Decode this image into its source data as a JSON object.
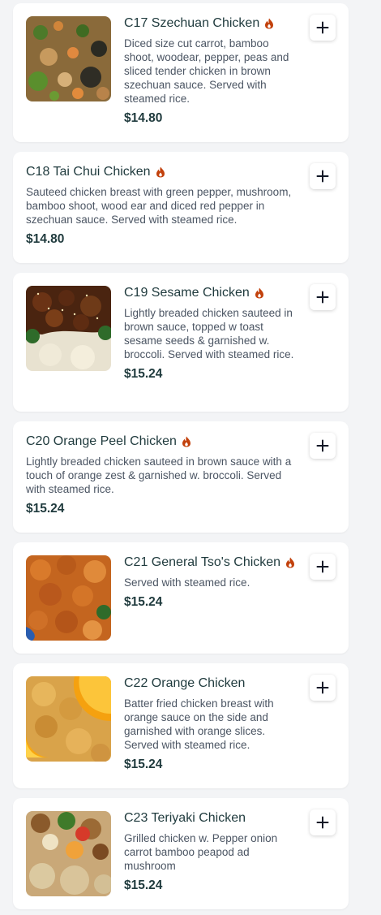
{
  "menu": {
    "items": [
      {
        "name": "C17 Szechuan Chicken",
        "spicy": true,
        "has_image": true,
        "image": "szechuan-chicken-photo",
        "description": "Diced size cut carrot, bamboo shoot, woodear, pepper, peas and sliced tender chicken in brown szechuan sauce. Served with steamed rice.",
        "price": "$14.80"
      },
      {
        "name": "C18 Tai Chui Chicken",
        "spicy": true,
        "has_image": false,
        "description": "Sauteed chicken breast with green pepper, mushroom, bamboo shoot, wood ear and diced red pepper in szechuan sauce. Served with steamed rice.",
        "price": "$14.80"
      },
      {
        "name": "C19 Sesame Chicken",
        "spicy": true,
        "has_image": true,
        "image": "sesame-chicken-photo",
        "description": "Lightly breaded chicken sauteed in brown sauce, topped w toast sesame seeds & garnished w. broccoli. Served with steamed rice.",
        "price": "$15.24"
      },
      {
        "name": "C20 Orange Peel Chicken",
        "spicy": true,
        "has_image": false,
        "description": "Lightly breaded chicken sauteed in brown sauce with a touch of orange zest & garnished w. broccoli. Served with steamed rice.",
        "price": "$15.24"
      },
      {
        "name": "C21 General Tso's Chicken",
        "spicy": true,
        "has_image": true,
        "image": "general-tsos-chicken-photo",
        "description": "Served with steamed rice.",
        "price": "$15.24"
      },
      {
        "name": "C22 Orange Chicken",
        "spicy": false,
        "has_image": true,
        "image": "orange-chicken-photo",
        "description": "Batter fried chicken breast with orange sauce on the side and garnished with orange slices. Served with steamed rice.",
        "price": "$15.24"
      },
      {
        "name": "C23 Teriyaki Chicken",
        "spicy": false,
        "has_image": true,
        "image": "teriyaki-chicken-photo",
        "description": "Grilled chicken w. Pepper onion carrot bamboo peapod ad mushroom",
        "price": "$15.24"
      }
    ]
  },
  "icons": {
    "spicy": "flame-icon",
    "add": "plus-icon"
  },
  "colors": {
    "background": "#f3f4f6",
    "card": "#ffffff",
    "title": "#1f3a3d",
    "description": "#4b5563",
    "spicy": "#c2410c"
  }
}
